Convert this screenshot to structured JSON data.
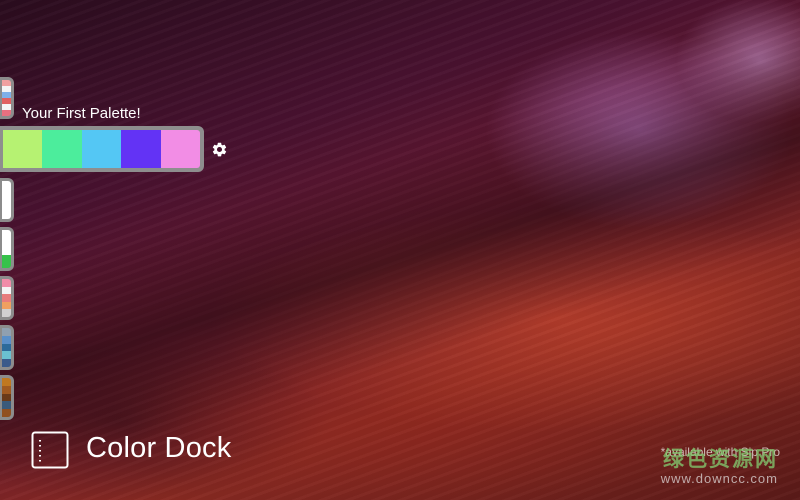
{
  "palette": {
    "title": "Your First Palette!",
    "colors": [
      "#b6f272",
      "#4ced9c",
      "#54c7f4",
      "#6333f5",
      "#f28de5"
    ]
  },
  "dock_tabs": [
    {
      "name": "palette-tab-stripes",
      "colors": [
        "#f0a0a0",
        "#f4f4f4",
        "#7fb0e8",
        "#e06060",
        "#f4f4f4",
        "#e87080"
      ]
    },
    {
      "name": "palette-tab-white",
      "colors": [
        "#ffffff"
      ]
    },
    {
      "name": "palette-tab-white-green",
      "colors": [
        "#ffffff",
        "#ffffff",
        "#36c24a"
      ]
    },
    {
      "name": "palette-tab-pastel",
      "colors": [
        "#f08ca8",
        "#f4f4f4",
        "#e87c7c",
        "#f0a060",
        "#d0d0d0"
      ]
    },
    {
      "name": "palette-tab-cool",
      "colors": [
        "#90a0b0",
        "#5a8fc8",
        "#2c6a9a",
        "#6ac0d0",
        "#3a5a8a"
      ]
    },
    {
      "name": "palette-tab-earth",
      "colors": [
        "#c07820",
        "#a05a20",
        "#6a3a18",
        "#3a5a7a",
        "#905020"
      ]
    }
  ],
  "gear_icon": "gear-icon",
  "brand": {
    "name": "Color Dock",
    "icon": "dock-window-icon"
  },
  "availability_note": "*available with Sip Pro",
  "watermark": {
    "cn": "绿色资源网",
    "url": "www.downcc.com"
  }
}
